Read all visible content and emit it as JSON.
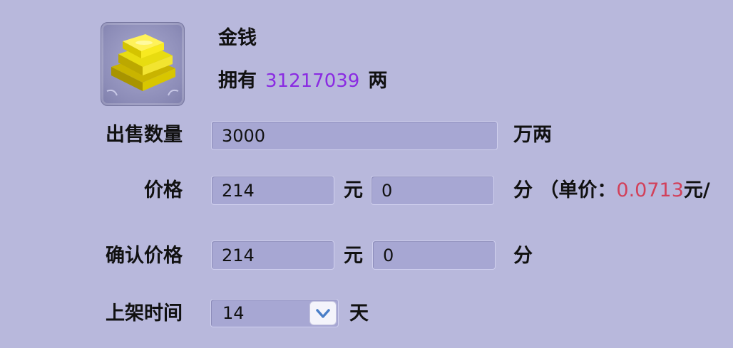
{
  "item": {
    "icon": "gold-bars-icon",
    "name": "金钱",
    "own_prefix": "拥有",
    "own_amount": "31217039",
    "own_unit": "两"
  },
  "quantity": {
    "label": "出售数量",
    "value": "3000",
    "unit": "万两"
  },
  "price": {
    "label": "价格",
    "yuan_value": "214",
    "yuan_unit": "元",
    "fen_value": "0",
    "fen_unit": "分",
    "unit_price_prefix": "（单价：",
    "unit_price_value": "0.0713",
    "unit_price_suffix": "元/"
  },
  "confirm_price": {
    "label": "确认价格",
    "yuan_value": "214",
    "yuan_unit": "元",
    "fen_value": "0",
    "fen_unit": "分"
  },
  "listing_time": {
    "label": "上架时间",
    "value": "14",
    "unit": "天"
  },
  "colors": {
    "background": "#b8b8dc",
    "own_amount": "#8a2be2",
    "unit_price": "#d2405a"
  }
}
